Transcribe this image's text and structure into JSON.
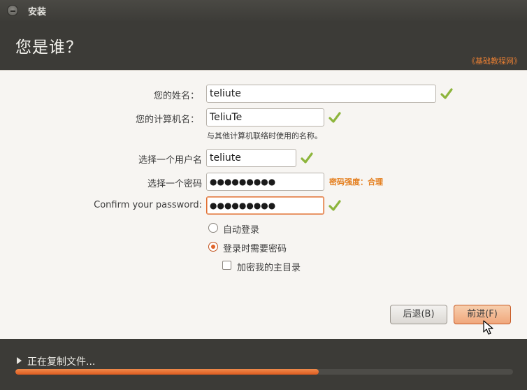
{
  "window": {
    "title": "安装"
  },
  "header": {
    "title": "您是谁？",
    "watermark": "《基础教程网》"
  },
  "form": {
    "name": {
      "label": "您的姓名：",
      "value": "teliute"
    },
    "computer": {
      "label": "您的计算机名：",
      "value": "TeliuTe",
      "hint": "与其他计算机联络时使用的名称。"
    },
    "username": {
      "label": "选择一个用户名",
      "value": "teliute"
    },
    "password": {
      "label": "选择一个密码",
      "value": "●●●●●●●●●",
      "strength": "密码强度：合理"
    },
    "confirm": {
      "label": "Confirm your password:",
      "value": "●●●●●●●●●"
    },
    "auto_login": {
      "label": "自动登录",
      "checked": false
    },
    "require_password": {
      "label": "登录时需要密码",
      "checked": true
    },
    "encrypt_home": {
      "label": "加密我的主目录",
      "checked": false
    }
  },
  "buttons": {
    "back": "后退(B)",
    "forward": "前进(F)"
  },
  "progress": {
    "label": "正在复制文件...",
    "percent": 61
  },
  "colors": {
    "accent": "#dd5b20",
    "check": "#8db53c",
    "strength": "#e47d1b"
  },
  "icons": {
    "check": "check-icon",
    "close": "close-icon",
    "expander": "triangle-right-icon",
    "cursor": "mouse-pointer-icon"
  }
}
